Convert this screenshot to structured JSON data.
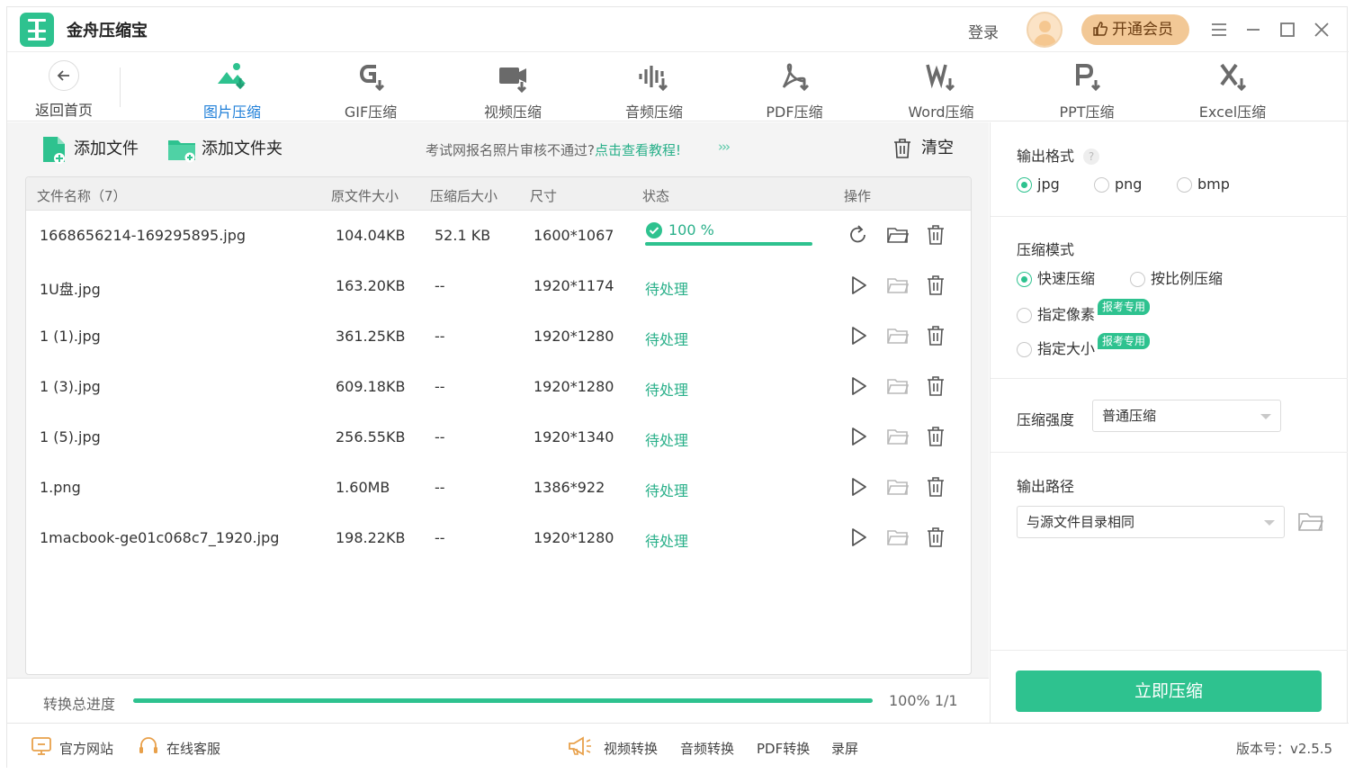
{
  "app": {
    "title": "金舟压缩宝",
    "login": "登录",
    "vip": "开通会员",
    "accent": "#2ec28f",
    "link_color": "#1f7fd8"
  },
  "toolbar": {
    "back": "返回首页",
    "tools": [
      {
        "label": "图片压缩",
        "icon": "image-compress-icon",
        "active": true
      },
      {
        "label": "GIF压缩",
        "icon": "gif-icon"
      },
      {
        "label": "视频压缩",
        "icon": "video-icon"
      },
      {
        "label": "音频压缩",
        "icon": "audio-icon"
      },
      {
        "label": "PDF压缩",
        "icon": "pdf-icon"
      },
      {
        "label": "Word压缩",
        "icon": "word-icon"
      },
      {
        "label": "PPT压缩",
        "icon": "ppt-icon"
      },
      {
        "label": "Excel压缩",
        "icon": "excel-icon"
      }
    ]
  },
  "actions": {
    "add_file": "添加文件",
    "add_folder": "添加文件夹",
    "notice_text": "考试网报名照片审核不通过?",
    "notice_link": "点击查看教程!",
    "notice_arrows": "›››",
    "clear": "清空"
  },
  "table": {
    "headers": {
      "name": "文件名称（7）",
      "orig_size": "原文件大小",
      "comp_size": "压缩后大小",
      "dims": "尺寸",
      "status": "状态",
      "ops": "操作"
    },
    "rows": [
      {
        "name": "1668656214-169295895.jpg",
        "orig": "104.04KB",
        "comp": "52.1 KB",
        "dims": "1600*1067",
        "status": "100 %",
        "progress": 1.0,
        "done": true
      },
      {
        "name": "1U盘.jpg",
        "orig": "163.20KB",
        "comp": "--",
        "dims": "1920*1174",
        "status": "待处理"
      },
      {
        "name": "1 (1).jpg",
        "orig": "361.25KB",
        "comp": "--",
        "dims": "1920*1280",
        "status": "待处理"
      },
      {
        "name": "1 (3).jpg",
        "orig": "609.18KB",
        "comp": "--",
        "dims": "1920*1280",
        "status": "待处理"
      },
      {
        "name": "1 (5).jpg",
        "orig": "256.55KB",
        "comp": "--",
        "dims": "1920*1340",
        "status": "待处理"
      },
      {
        "name": "1.png",
        "orig": "1.60MB",
        "comp": "--",
        "dims": "1386*922",
        "status": "待处理"
      },
      {
        "name": "1macbook-ge01c068c7_1920.jpg",
        "orig": "198.22KB",
        "comp": "--",
        "dims": "1920*1280",
        "status": "待处理"
      }
    ]
  },
  "total": {
    "label": "转换总进度",
    "progress": 1.0,
    "value": "100% 1/1"
  },
  "settings": {
    "format_title": "输出格式",
    "help": "?",
    "formats": [
      "jpg",
      "png",
      "bmp"
    ],
    "format_selected": "jpg",
    "mode_title": "压缩模式",
    "modes": [
      "快速压缩",
      "按比例压缩",
      "指定像素",
      "指定大小"
    ],
    "mode_selected": "快速压缩",
    "badge": "报考专用",
    "strength_title": "压缩强度",
    "strength_value": "普通压缩",
    "path_title": "输出路径",
    "path_value": "与源文件目录相同",
    "compress_button": "立即压缩"
  },
  "footer": {
    "website": "官方网站",
    "service": "在线客服",
    "links": [
      "视频转换",
      "音频转换",
      "PDF转换",
      "录屏"
    ],
    "version": "版本号：v2.5.5"
  }
}
